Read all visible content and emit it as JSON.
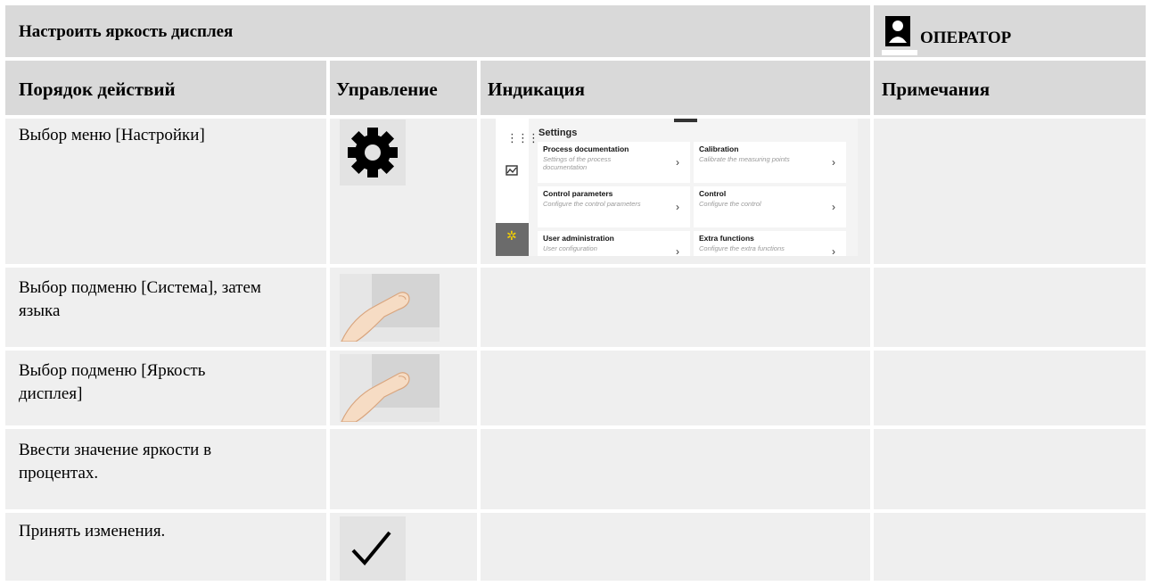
{
  "header": {
    "title": "Настроить яркость дисплея",
    "role": "ОПЕРАТОР"
  },
  "columns": {
    "steps": "Порядок действий",
    "control": "Управление",
    "display": "Индикация",
    "notes": "Примечания"
  },
  "rows": [
    {
      "step": "Выбор меню [Настройки]",
      "control_icon": "gear-icon"
    },
    {
      "step": "Выбор подменю [Система], затем языка",
      "control_icon": "finger-tap-icon"
    },
    {
      "step": "Выбор подменю [Яркость дисплея]",
      "control_icon": "finger-tap-icon"
    },
    {
      "step": "Ввести значение яркости в процентах.",
      "control_icon": ""
    },
    {
      "step": "Принять изменения.",
      "control_icon": "checkmark-icon"
    }
  ],
  "settings_screen": {
    "heading": "Settings",
    "cards": [
      {
        "title": "Process documentation",
        "subtitle": "Settings of the process documentation"
      },
      {
        "title": "Calibration",
        "subtitle": "Calibrate the measuring points"
      },
      {
        "title": "Control parameters",
        "subtitle": "Configure the control parameters"
      },
      {
        "title": "Control",
        "subtitle": "Configure the control"
      },
      {
        "title": "User administration",
        "subtitle": "User configuration"
      },
      {
        "title": "Extra functions",
        "subtitle": "Configure the extra functions"
      }
    ],
    "sidebar_icons": [
      "grid-menu-icon",
      "chart-icon",
      "settings-sun-icon"
    ]
  }
}
